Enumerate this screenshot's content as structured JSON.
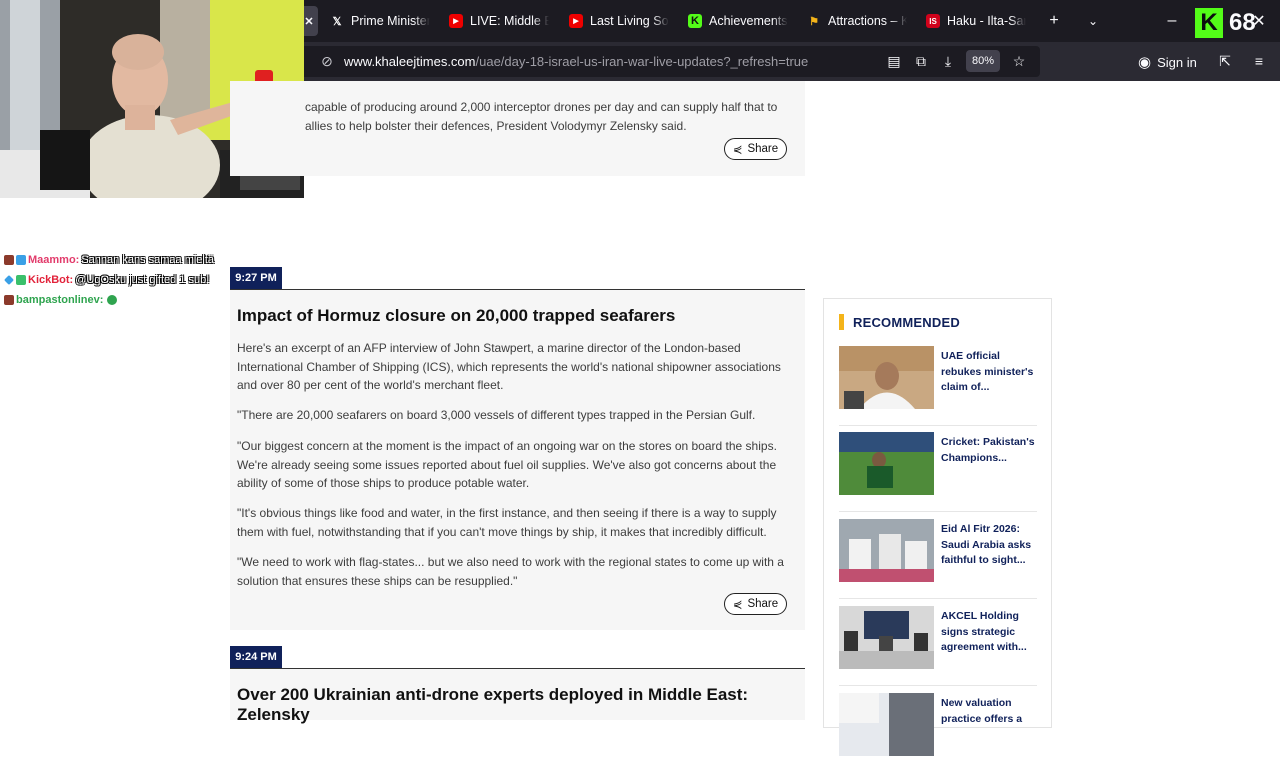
{
  "browser": {
    "tabs": [
      {
        "title": "Prime Minister",
        "icon": "x-icon"
      },
      {
        "title": "LIVE: Middle Ea",
        "icon": "youtube-icon"
      },
      {
        "title": "Last Living Soul",
        "icon": "youtube-icon"
      },
      {
        "title": "Achievements",
        "icon": "kick-icon"
      },
      {
        "title": "Attractions – Ki",
        "icon": "flag-icon"
      },
      {
        "title": "Haku - Ilta-Sano",
        "icon": "is-icon"
      }
    ],
    "url_domain": "www.khaleejtimes.com",
    "url_path": "/uae/day-18-israel-us-iran-war-live-updates?_refresh=true",
    "zoom": "80%",
    "sign_in": "Sign in"
  },
  "stream": {
    "viewer_count": "68",
    "chat": [
      {
        "user": "Maammo:",
        "message": "Sannan kans samaa mieltä",
        "color": "#e23b6b"
      },
      {
        "user": "KickBot:",
        "message": "@UgOsku just gifted 1 sub!",
        "color": "#e2233b"
      },
      {
        "user": "bampastonlinev:",
        "message": "",
        "color": "#2fa44f"
      }
    ]
  },
  "article": {
    "prev_text": "capable of producing around 2,000 interceptor drones per day and can supply half that to allies to help bolster their defences, President Volodymyr Zelensky said.",
    "share_label": "Share",
    "post1": {
      "time": "9:27 PM",
      "headline": "Impact of Hormuz closure on 20,000 trapped seafarers",
      "paragraphs": [
        "Here's an excerpt of an AFP interview of John Stawpert, a marine director of the London-based International Chamber of Shipping (ICS), which represents the world's national shipowner associations and over 80 per cent of the world's merchant fleet.",
        "\"There are 20,000 seafarers on board 3,000 vessels of different types trapped in the Persian Gulf.",
        "\"Our biggest concern at the moment is the impact of an ongoing war on the stores on board the ships. We're already seeing some issues reported about fuel oil supplies. We've also got concerns about the ability of some of those ships to produce potable water.",
        "\"It's obvious things like food and water, in the first instance, and then seeing if there is a way to supply them with fuel, notwithstanding that if you can't move things by ship, it makes that incredibly difficult.",
        "\"We need to work with flag-states... but we also need to work with the regional states to come up with a solution that ensures these ships can be resupplied.\""
      ]
    },
    "post2": {
      "time": "9:24 PM",
      "headline": "Over 200 Ukrainian anti-drone experts deployed in Middle East: Zelensky"
    }
  },
  "sidebar": {
    "title": "RECOMMENDED",
    "items": [
      {
        "title": "UAE official rebukes minister's claim of..."
      },
      {
        "title": "Cricket: Pakistan's Champions..."
      },
      {
        "title": "Eid Al Fitr 2026: Saudi Arabia asks faithful to sight..."
      },
      {
        "title": "AKCEL Holding signs strategic agreement with..."
      },
      {
        "title": "New valuation practice offers a"
      }
    ]
  },
  "colors": {
    "brand_navy": "#10215a",
    "accent_yellow": "#f4b41a",
    "kick_green": "#53fc18",
    "chrome_dark": "#1c1b22"
  }
}
